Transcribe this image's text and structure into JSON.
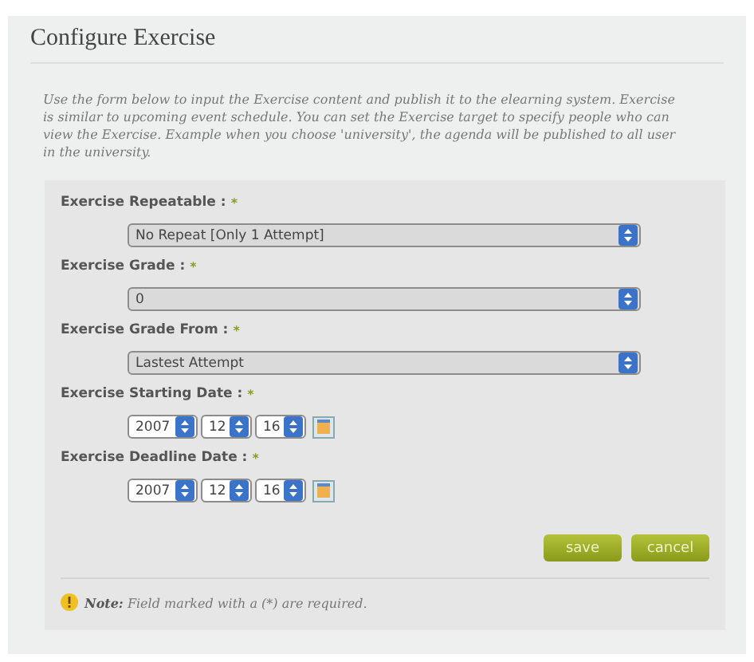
{
  "title": "Configure Exercise",
  "description": "Use the form below to input the Exercise content and publish it to the elearning system. Exercise is similar to upcoming event schedule. You can set the Exercise target to specify people who can view the Exercise. Example when you choose 'university', the agenda will be published to all user in the university.",
  "fields": [
    {
      "kind": "select",
      "label": "Exercise Repeatable :",
      "required_mark": "*",
      "value": "No Repeat [Only 1 Attempt]"
    },
    {
      "kind": "select",
      "label": "Exercise Grade :",
      "required_mark": "*",
      "value": "0"
    },
    {
      "kind": "select",
      "label": "Exercise Grade From :",
      "required_mark": "*",
      "value": "Lastest Attempt"
    },
    {
      "kind": "date",
      "label": "Exercise Starting Date :",
      "required_mark": "*",
      "year": "2007",
      "month": "12",
      "day": "16"
    },
    {
      "kind": "date",
      "label": "Exercise Deadline Date :",
      "required_mark": "*",
      "year": "2007",
      "month": "12",
      "day": "16"
    }
  ],
  "buttons": [
    "save",
    "cancel"
  ],
  "note": {
    "label": "Note:",
    "text": "Field marked with a (*) are required."
  }
}
